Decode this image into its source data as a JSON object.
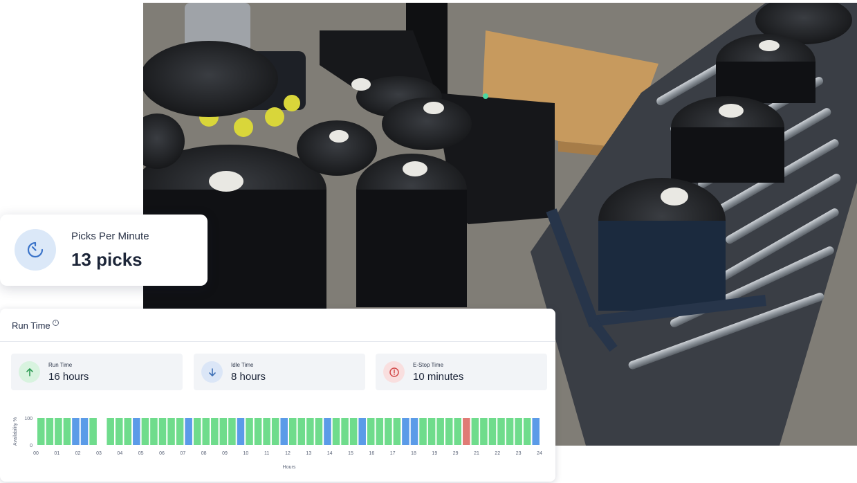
{
  "photo": {
    "alt_icon": "warehouse-photo"
  },
  "ppm_card": {
    "icon": "timer-icon",
    "label": "Picks Per Minute",
    "value": "13 picks"
  },
  "run_time_panel": {
    "title": "Run Time",
    "info_icon": "info-icon",
    "stats": [
      {
        "label": "Run Time",
        "value": "16 hours",
        "icon": "arrow-up-icon",
        "color": "#d8f3df",
        "icon_color": "#2e9c55"
      },
      {
        "label": "Idle Time",
        "value": "8 hours",
        "icon": "arrow-down-icon",
        "color": "#dbe6f7",
        "icon_color": "#3d6fb5"
      },
      {
        "label": "E-Stop Time",
        "value": "10 minutes",
        "icon": "alert-icon",
        "color": "#f9dfdf",
        "icon_color": "#d24b4b"
      }
    ]
  },
  "chart_data": {
    "type": "bar",
    "ylabel": "Availability %",
    "xlabel": "Hours",
    "ylim": [
      0,
      100
    ],
    "yticks": [
      "0",
      "100"
    ],
    "x_tick_labels": [
      "00",
      "01",
      "02",
      "03",
      "04",
      "05",
      "06",
      "07",
      "08",
      "09",
      "10",
      "11",
      "12",
      "13",
      "14",
      "15",
      "16",
      "17",
      "18",
      "19",
      "29",
      "21",
      "22",
      "23",
      "24"
    ],
    "colors": {
      "run": "#6fdc8c",
      "idle": "#5b9be8",
      "estop": "#e07b75"
    },
    "bars": [
      "run",
      "run",
      "run",
      "run",
      "idle",
      "idle",
      "run",
      "gap",
      "run",
      "run",
      "run",
      "idle",
      "run",
      "run",
      "run",
      "run",
      "run",
      "idle",
      "run",
      "run",
      "run",
      "run",
      "run",
      "idle",
      "run",
      "run",
      "run",
      "run",
      "idle",
      "run",
      "run",
      "run",
      "run",
      "idle",
      "run",
      "run",
      "run",
      "idle",
      "run",
      "run",
      "run",
      "run",
      "idle",
      "idle",
      "run",
      "run",
      "run",
      "run",
      "run",
      "estop",
      "run",
      "run",
      "run",
      "run",
      "run",
      "run",
      "run",
      "idle"
    ],
    "values": [
      100,
      100,
      100,
      100,
      100,
      100,
      100,
      0,
      100,
      100,
      100,
      100,
      100,
      100,
      100,
      100,
      100,
      100,
      100,
      100,
      100,
      100,
      100,
      100,
      100,
      100,
      100,
      100,
      100,
      100,
      100,
      100,
      100,
      100,
      100,
      100,
      100,
      100,
      100,
      100,
      100,
      100,
      100,
      100,
      100,
      100,
      100,
      100,
      100,
      100,
      100,
      100,
      100,
      100,
      100,
      100,
      100,
      100
    ]
  }
}
